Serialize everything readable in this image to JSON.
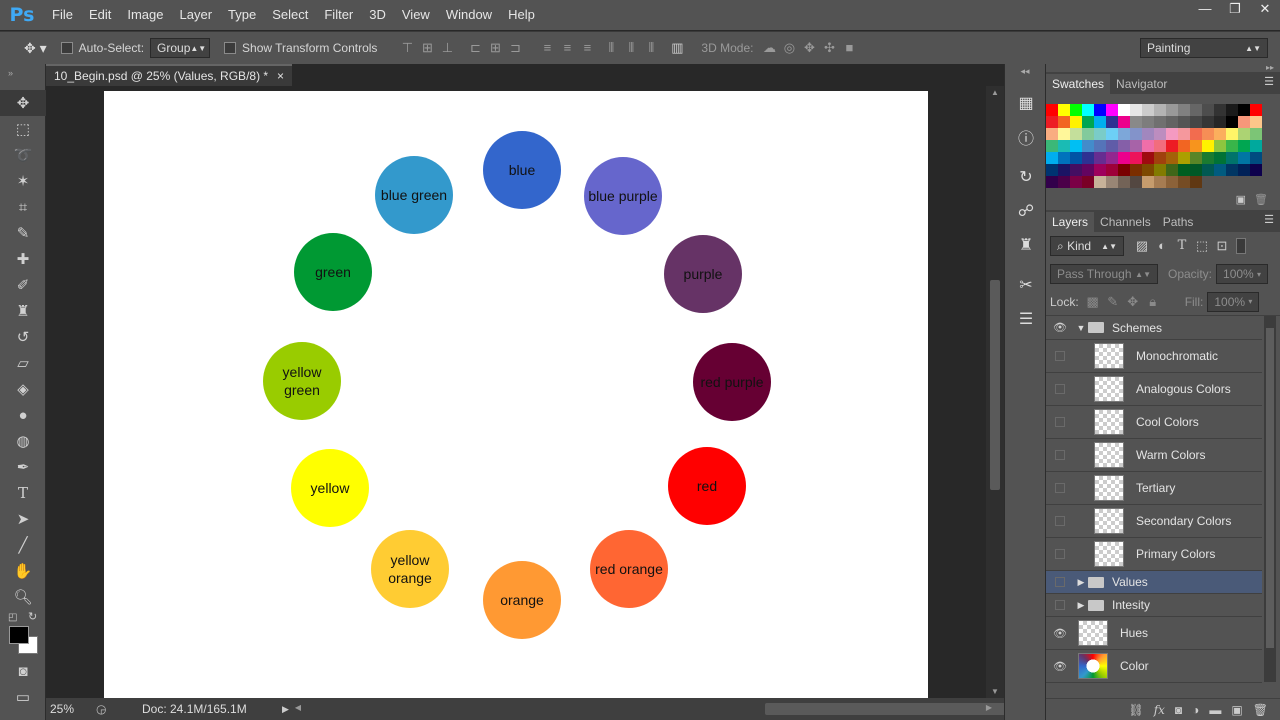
{
  "menubar": {
    "logo": "Ps",
    "items": [
      "File",
      "Edit",
      "Image",
      "Layer",
      "Type",
      "Select",
      "Filter",
      "3D",
      "View",
      "Window",
      "Help"
    ],
    "window_controls": [
      "—",
      "❐",
      "✕"
    ]
  },
  "options": {
    "auto_select_label": "Auto-Select:",
    "auto_select_value": "Group",
    "show_transform_label": "Show Transform Controls",
    "mode_3d_label": "3D Mode:",
    "workspace_value": "Painting"
  },
  "document": {
    "tab_title": "10_Begin.psd @ 25% (Values, RGB/8) *",
    "close_glyph": "×",
    "zoom": "25%",
    "doc_info": "Doc: 24.1M/165.1M"
  },
  "wheel": {
    "colors": {
      "blue": "#3366cc",
      "blue_purple": "#6666cc",
      "purple": "#663366",
      "red_purple": "#660033",
      "red": "#ff0000",
      "red_orange": "#ff6633",
      "orange": "#ff9933",
      "yellow_orange": "#ffcc33",
      "yellow": "#ffff00",
      "yellow_green": "#99cc00",
      "green": "#009933",
      "blue_green": "#3399cc"
    },
    "labels": {
      "blue": "blue",
      "blue_purple": "blue purple",
      "purple": "purple",
      "red_purple": "red purple",
      "red": "red",
      "red_orange": "red orange",
      "orange": "orange",
      "yellow_orange": "yellow orange",
      "yellow": "yellow",
      "yellow_green": "yellow green",
      "green": "green",
      "blue_green": "blue green"
    }
  },
  "swatches_panel": {
    "tabs": [
      "Swatches",
      "Navigator"
    ],
    "colors": [
      "#ff0000",
      "#ffff00",
      "#00ff00",
      "#00ffff",
      "#0000ff",
      "#ff00ff",
      "#ffffff",
      "#e6e6e6",
      "#cccccc",
      "#b3b3b3",
      "#999999",
      "#808080",
      "#666666",
      "#4d4d4d",
      "#333333",
      "#1a1a1a",
      "#000000",
      "#ff0000",
      "#ed1c24",
      "#f26522",
      "#fff200",
      "#00a651",
      "#00aeef",
      "#2e3192",
      "#ec008c",
      "#898989",
      "#7d7d7d",
      "#707070",
      "#636363",
      "#555555",
      "#464646",
      "#363636",
      "#262626",
      "#000000",
      "#f7977a",
      "#fdc68a",
      "#f9ad81",
      "#fff79a",
      "#c4df9b",
      "#82ca9c",
      "#7accc8",
      "#6dcff6",
      "#7da7d9",
      "#8393ca",
      "#a187be",
      "#bc8dbf",
      "#f49ac1",
      "#f5989d",
      "#f26c4f",
      "#f68e56",
      "#fbaf5d",
      "#fff568",
      "#acd373",
      "#7cc576",
      "#3bb878",
      "#1abbb4",
      "#00bff3",
      "#438ccb",
      "#5574b9",
      "#605ca8",
      "#855fa8",
      "#a763a8",
      "#f06ea9",
      "#f26d7d",
      "#ed1c24",
      "#f26522",
      "#f7941d",
      "#fff200",
      "#8dc63f",
      "#39b54a",
      "#00a651",
      "#00a99d",
      "#00aeef",
      "#0072bc",
      "#0054a6",
      "#2e3192",
      "#662d91",
      "#92278f",
      "#ec008c",
      "#ed145b",
      "#9e0b0f",
      "#a0410d",
      "#a36209",
      "#aba000",
      "#598527",
      "#1a7b30",
      "#007236",
      "#00746b",
      "#0076a3",
      "#004b80",
      "#003471",
      "#1b1464",
      "#440e62",
      "#630460",
      "#9e005d",
      "#9e0039",
      "#790000",
      "#7b2e00",
      "#7d4900",
      "#827b00",
      "#406618",
      "#005e20",
      "#005826",
      "#005952",
      "#005b7f",
      "#003663",
      "#002157",
      "#0d004c",
      "#32004b",
      "#4b0049",
      "#7b0046",
      "#7a0026",
      "#c7b299",
      "#998675",
      "#736357",
      "#534741",
      "#c69c6d",
      "#a67c52",
      "#8c6239",
      "#754c24",
      "#603813"
    ]
  },
  "layers_panel": {
    "tabs": [
      "Layers",
      "Channels",
      "Paths"
    ],
    "filter_label": "Kind",
    "blend_mode": "Pass Through",
    "opacity_label": "Opacity:",
    "opacity_value": "100%",
    "lock_label": "Lock:",
    "fill_label": "Fill:",
    "fill_value": "100%",
    "layers": [
      {
        "name": "Schemes",
        "kind": "group",
        "expanded": true,
        "visible": true
      },
      {
        "name": "Monochromatic",
        "kind": "layer",
        "visible": false
      },
      {
        "name": "Analogous Colors",
        "kind": "layer",
        "visible": false
      },
      {
        "name": "Cool Colors",
        "kind": "layer",
        "visible": false
      },
      {
        "name": "Warm Colors",
        "kind": "layer",
        "visible": false
      },
      {
        "name": "Tertiary",
        "kind": "layer",
        "visible": false
      },
      {
        "name": "Secondary Colors",
        "kind": "layer",
        "visible": false
      },
      {
        "name": "Primary Colors",
        "kind": "layer",
        "visible": false
      },
      {
        "name": "Values",
        "kind": "group",
        "expanded": false,
        "visible": false,
        "selected": true
      },
      {
        "name": "Intesity",
        "kind": "group",
        "expanded": false,
        "visible": false
      },
      {
        "name": "Hues",
        "kind": "layer",
        "visible": true
      },
      {
        "name": "Color",
        "kind": "layer",
        "visible": true
      }
    ]
  },
  "colors": {
    "selected_layer_bg": "#4a5a78",
    "accent": "#3fa9f5"
  }
}
